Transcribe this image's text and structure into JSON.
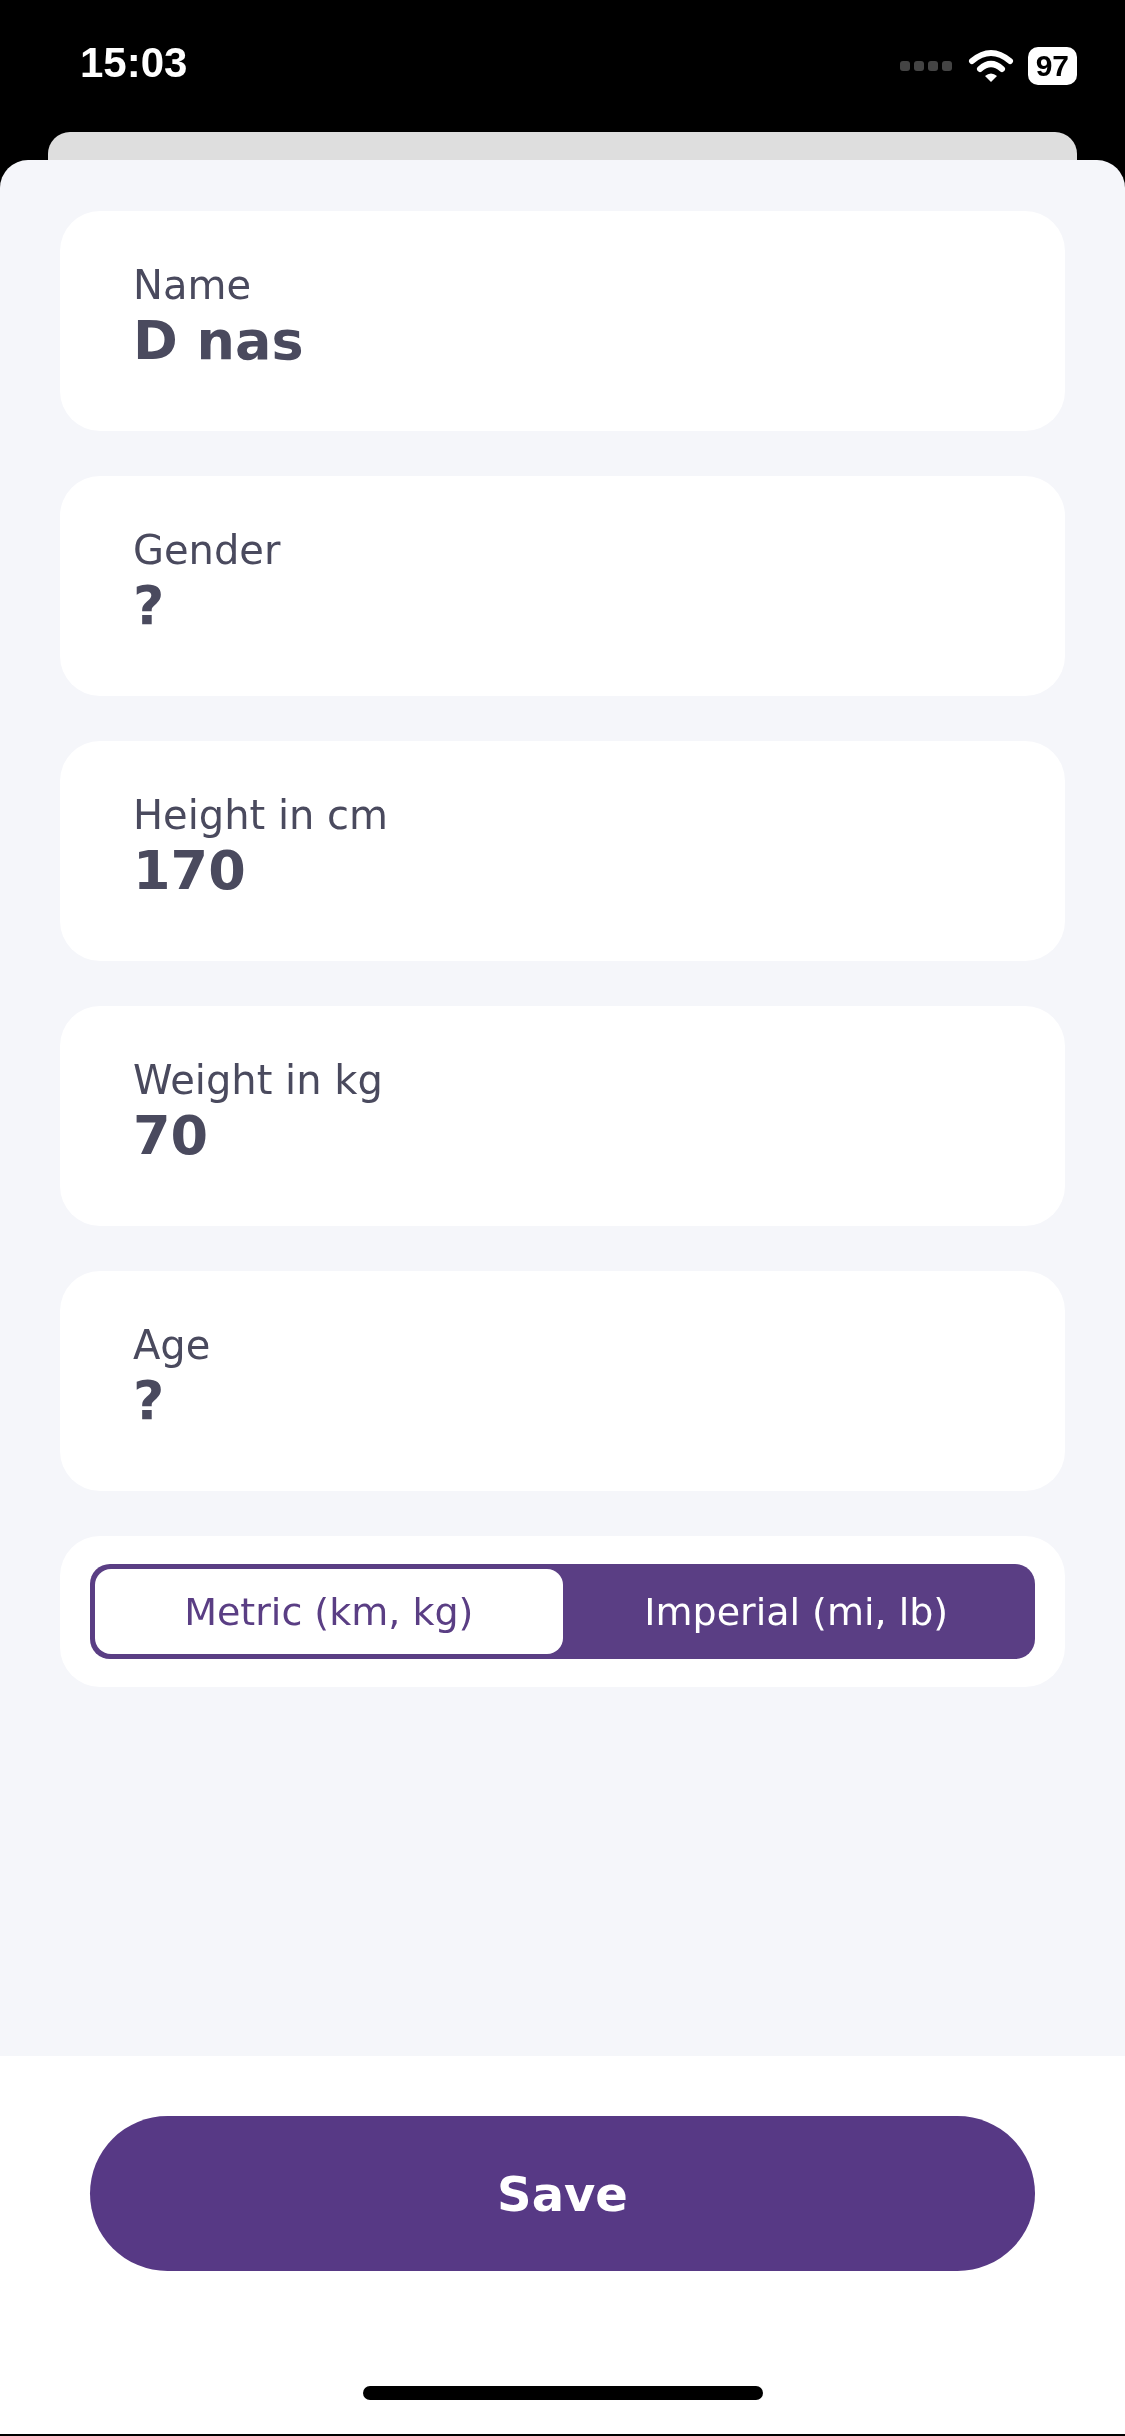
{
  "status_bar": {
    "time": "15:03",
    "battery": "97"
  },
  "fields": [
    {
      "label": "Name",
      "value": "D nas"
    },
    {
      "label": "Gender",
      "value": "?"
    },
    {
      "label": "Height in cm",
      "value": "170"
    },
    {
      "label": "Weight in kg",
      "value": "70"
    },
    {
      "label": "Age",
      "value": "?"
    }
  ],
  "units": [
    {
      "label": "Metric (km, kg)",
      "selected": true
    },
    {
      "label": "Imperial (mi, lb)",
      "selected": false
    }
  ],
  "save_button": "Save"
}
